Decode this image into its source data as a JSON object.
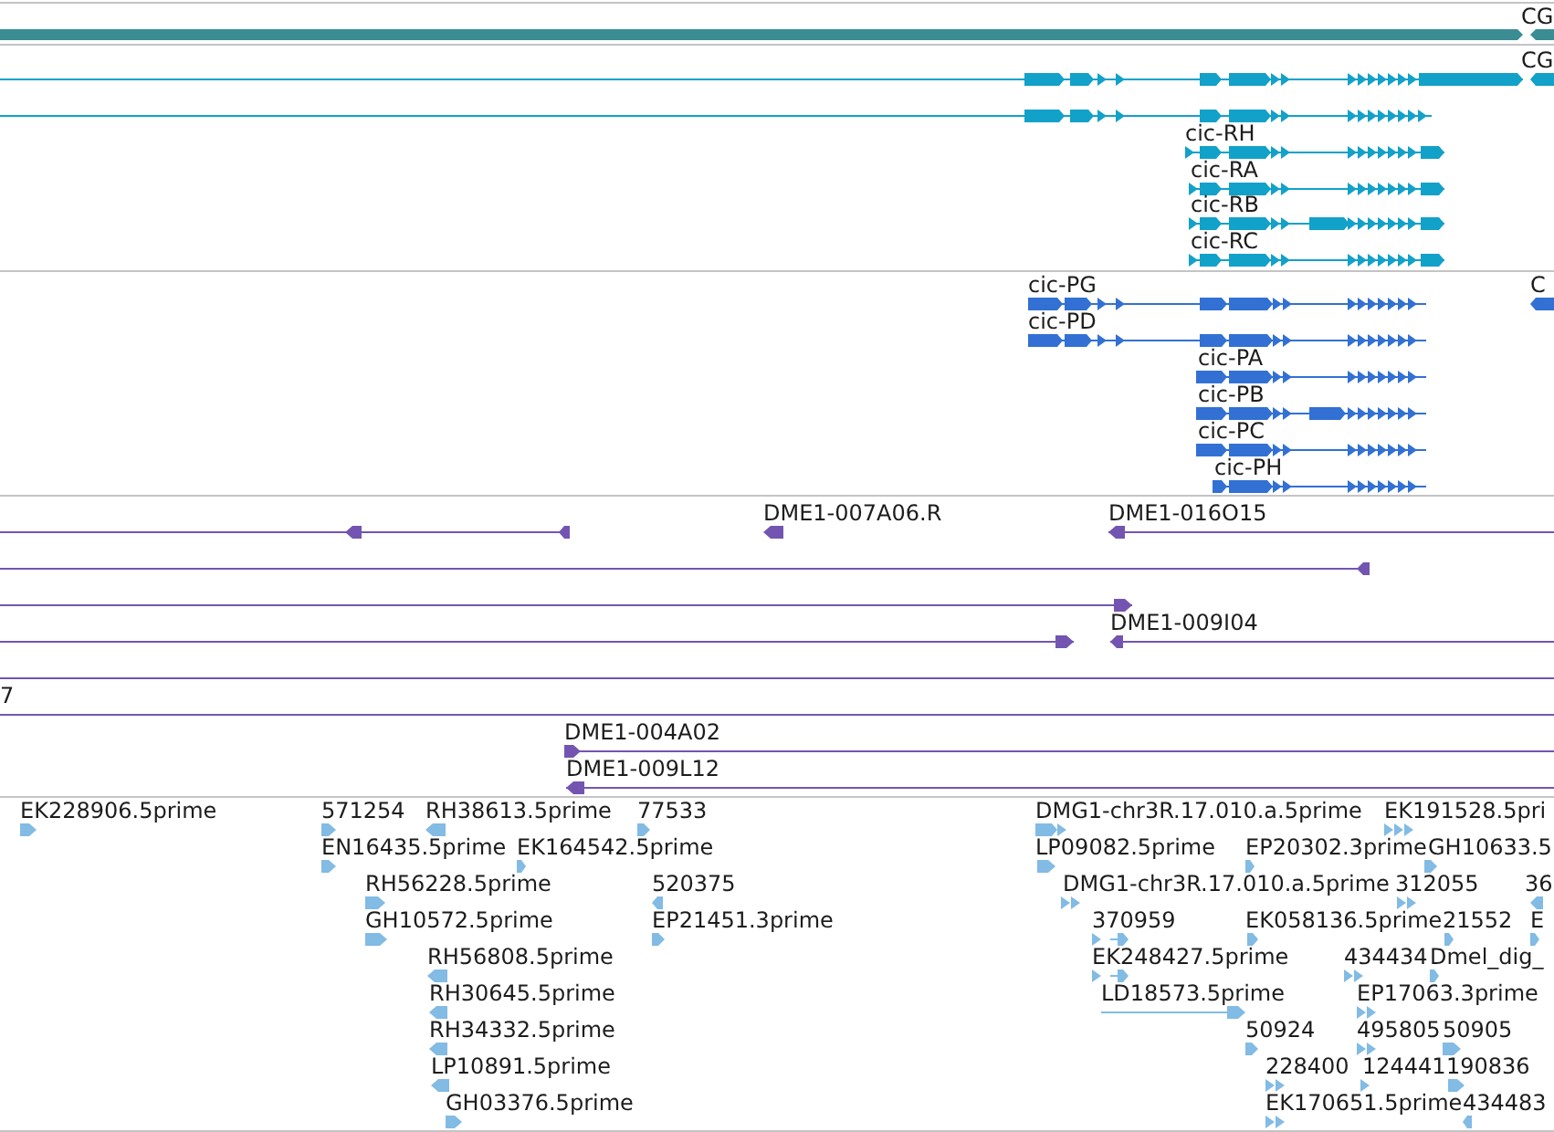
{
  "tracks": [
    {
      "kind": "gene",
      "features": [
        {
          "reverse": false
        },
        {
          "label": "CG",
          "reverse": true
        }
      ]
    },
    {
      "kind": "transcript",
      "features": [
        {
          "reverse": false
        },
        {
          "label": "CG",
          "reverse": true
        },
        {
          "reverse": false
        },
        {
          "label": "cic-RH",
          "reverse": false
        },
        {
          "label": "cic-RA",
          "reverse": false
        },
        {
          "label": "cic-RB",
          "reverse": false
        },
        {
          "label": "cic-RC",
          "reverse": false
        }
      ]
    },
    {
      "kind": "protein",
      "features": [
        {
          "label": "cic-PG",
          "reverse": false
        },
        {
          "label": "C",
          "reverse": true
        },
        {
          "label": "cic-PD",
          "reverse": false
        },
        {
          "label": "cic-PA",
          "reverse": false
        },
        {
          "label": "cic-PB",
          "reverse": false
        },
        {
          "label": "cic-PC",
          "reverse": false
        },
        {
          "label": "cic-PH",
          "reverse": false
        }
      ]
    },
    {
      "kind": "clone",
      "features": [
        {
          "kind": "ended",
          "reverse": true
        },
        {
          "kind": "ended",
          "label": "DME1-007A06.R",
          "reverse": true
        },
        {
          "kind": "ended",
          "label": "DME1-016O15",
          "reverse": true
        },
        {
          "kind": "ended",
          "reverse": true
        },
        {
          "kind": "ended",
          "reverse": false
        },
        {
          "kind": "ended",
          "reverse": false
        },
        {
          "kind": "ended",
          "label": "DME1-009I04",
          "reverse": true
        },
        {
          "kind": "spanning"
        },
        {
          "kind": "spanning",
          "label": "7"
        },
        {
          "kind": "ended",
          "label": "DME1-004A02",
          "reverse": false
        },
        {
          "kind": "ended",
          "label": "DME1-009L12",
          "reverse": true
        }
      ]
    },
    {
      "kind": "est",
      "features": [
        {
          "label": "EK228906.5prime",
          "reverse": false
        },
        {
          "label": "571254",
          "reverse": false
        },
        {
          "label": "RH38613.5prime",
          "reverse": true
        },
        {
          "label": "77533",
          "reverse": false
        },
        {
          "label": "DMG1-chr3R.17.010.a.5prime",
          "reverse": false
        },
        {
          "label": "EK191528.5pri",
          "reverse": false
        },
        {
          "label": "EN16435.5prime",
          "reverse": false
        },
        {
          "label": "EK164542.5prime",
          "reverse": false
        },
        {
          "label": "LP09082.5prime",
          "reverse": false
        },
        {
          "label": "EP20302.3prime",
          "reverse": false
        },
        {
          "label": "GH10633.5",
          "reverse": false
        },
        {
          "label": "RH56228.5prime",
          "reverse": false
        },
        {
          "label": "520375",
          "reverse": true
        },
        {
          "label": "DMG1-chr3R.17.010.a.5prime",
          "reverse": false
        },
        {
          "label": "312055",
          "reverse": false
        },
        {
          "label": "36",
          "reverse": true
        },
        {
          "label": "GH10572.5prime",
          "reverse": false
        },
        {
          "label": "EP21451.3prime",
          "reverse": false
        },
        {
          "label": "370959",
          "reverse": false
        },
        {
          "label": "EK058136.5prime",
          "reverse": false
        },
        {
          "label": "21552",
          "reverse": false
        },
        {
          "label": "E",
          "reverse": false
        },
        {
          "label": "RH56808.5prime",
          "reverse": true
        },
        {
          "label": "EK248427.5prime",
          "reverse": false
        },
        {
          "label": "434434",
          "reverse": false
        },
        {
          "label": "Dmel_dig_",
          "reverse": false
        },
        {
          "label": "RH30645.5prime",
          "reverse": true
        },
        {
          "label": "LD18573.5prime",
          "reverse": false
        },
        {
          "label": "EP17063.3prime",
          "reverse": false
        },
        {
          "label": "RH34332.5prime",
          "reverse": true
        },
        {
          "label": "50924",
          "reverse": false
        },
        {
          "label": "495805",
          "reverse": false
        },
        {
          "label": "50905",
          "reverse": false
        },
        {
          "label": "LP10891.5prime",
          "reverse": true
        },
        {
          "label": "228400",
          "reverse": false
        },
        {
          "label": "124441",
          "reverse": false
        },
        {
          "label": "190836",
          "reverse": false
        },
        {
          "label": "GH03376.5prime",
          "reverse": false
        },
        {
          "label": "EK170651.5prime",
          "reverse": false
        },
        {
          "label": "434483",
          "reverse": true
        }
      ]
    }
  ]
}
